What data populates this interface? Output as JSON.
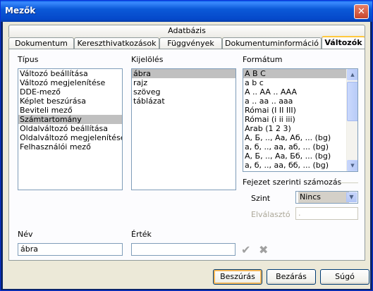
{
  "window": {
    "title": "Mezők",
    "close_glyph": "✕"
  },
  "tabs": {
    "row1": [
      {
        "label": "Adatbázis"
      }
    ],
    "row2": [
      {
        "label": "Dokumentum"
      },
      {
        "label": "Kereszthivatkozások"
      },
      {
        "label": "Függvények"
      },
      {
        "label": "Dokumentuminformáció"
      },
      {
        "label": "Változók",
        "active": true
      }
    ]
  },
  "tipus": {
    "label": "Típus",
    "items": [
      "Változó beállítása",
      "Változó megjelenítése",
      "DDE-mező",
      "Képlet beszúrása",
      "Beviteli mező",
      "Számtartomány",
      "Oldalváltozó beállítása",
      "Oldalváltozó megjelenítése",
      "Felhasználói mező"
    ],
    "selected": "Számtartomány"
  },
  "kijeloles": {
    "label": "Kijelölés",
    "items": [
      "ábra",
      "rajz",
      "szöveg",
      "táblázat"
    ],
    "selected": "ábra"
  },
  "formatum": {
    "label": "Formátum",
    "items": [
      "A B C",
      "a b c",
      "A .. AA .. AAA",
      "a .. aa .. aaa",
      "Római (I II III)",
      "Római (i ii iii)",
      "Arab (1 2 3)",
      "А, Б, .., Аа, Аб, ... (bg)",
      "а, б, .., аа, аб, ... (bg)",
      "А, Б, .., Аа, Бб, ... (bg)",
      "а, б, .., аа, бб, ... (bg)"
    ],
    "selected": "A B C"
  },
  "fejezet": {
    "title": "Fejezet szerinti számozás",
    "szint_label": "Szint",
    "szint_value": "Nincs",
    "elvalaszto_label": "Elválasztó",
    "elvalaszto_value": "."
  },
  "nev": {
    "label": "Név",
    "value": "ábra"
  },
  "ertek": {
    "label": "Érték",
    "value": ""
  },
  "buttons": {
    "insert": "Beszúrás",
    "close": "Bezárás",
    "help": "Súgó"
  },
  "icons": {
    "apply": "✔",
    "delete": "✖"
  }
}
